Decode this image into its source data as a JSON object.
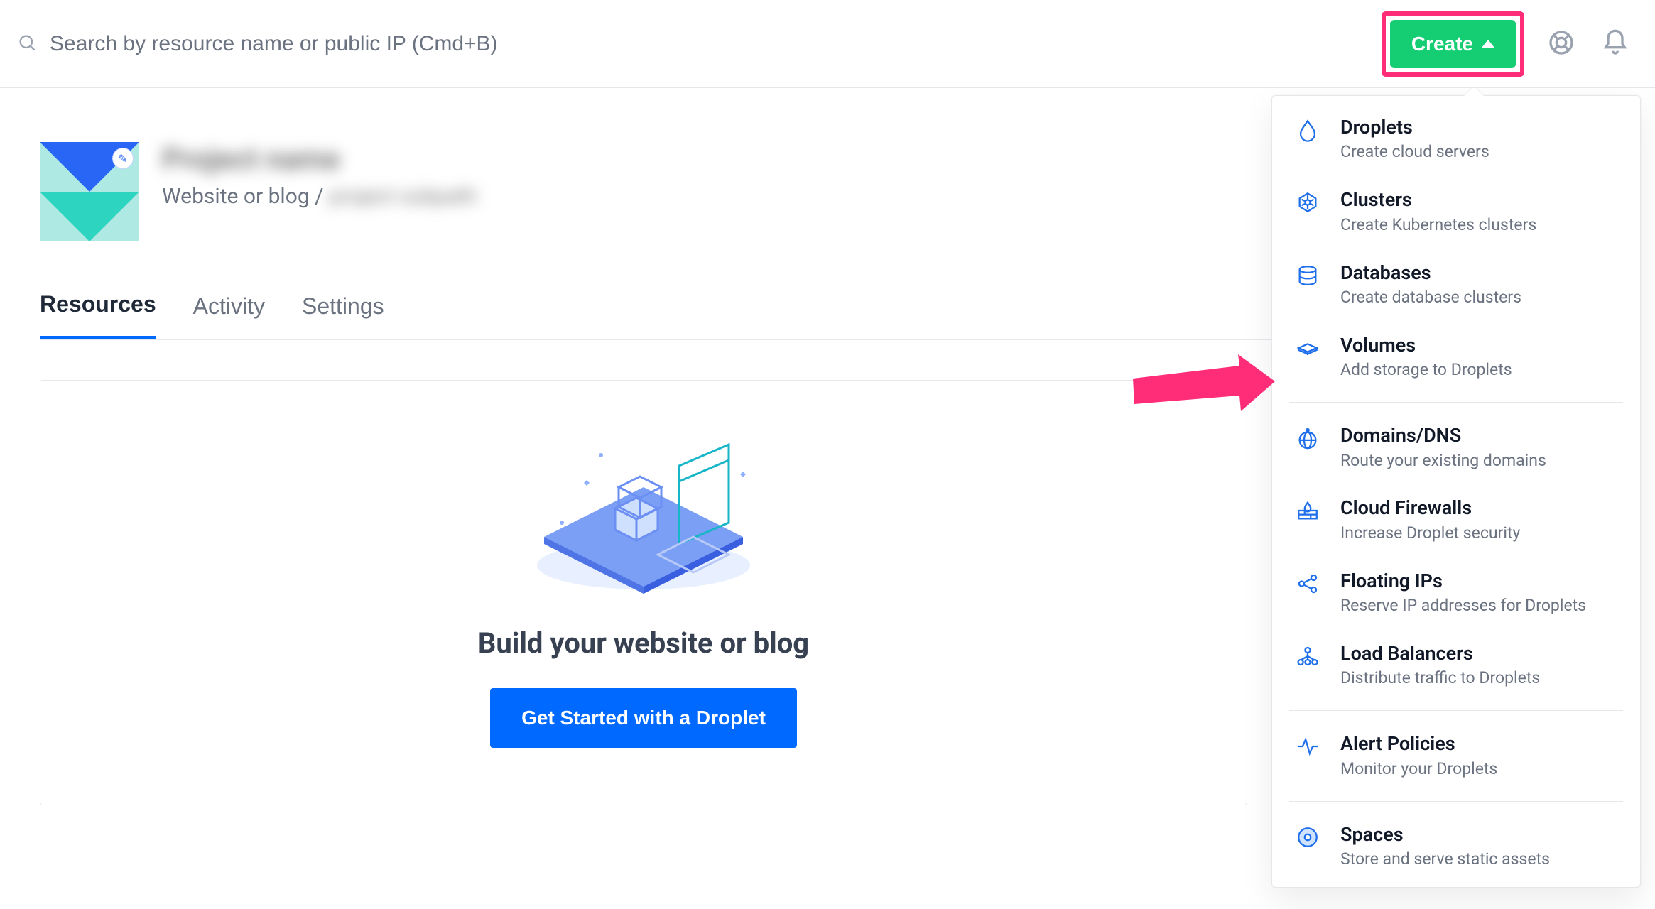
{
  "topbar": {
    "search_placeholder": "Search by resource name or public IP (Cmd+B)",
    "create_label": "Create"
  },
  "project": {
    "name_blurred": "Project name",
    "subtitle_prefix": "Website or blog /",
    "subtitle_blurred": "project subpath"
  },
  "tabs": [
    {
      "id": "resources",
      "label": "Resources",
      "active": true
    },
    {
      "id": "activity",
      "label": "Activity",
      "active": false
    },
    {
      "id": "settings",
      "label": "Settings",
      "active": false
    }
  ],
  "empty_state": {
    "heading": "Build your website or blog",
    "cta_label": "Get Started with a Droplet"
  },
  "create_menu": {
    "groups": [
      [
        {
          "id": "droplets",
          "title": "Droplets",
          "sub": "Create cloud servers",
          "icon": "droplet"
        },
        {
          "id": "clusters",
          "title": "Clusters",
          "sub": "Create Kubernetes clusters",
          "icon": "k8s"
        },
        {
          "id": "databases",
          "title": "Databases",
          "sub": "Create database clusters",
          "icon": "db"
        },
        {
          "id": "volumes",
          "title": "Volumes",
          "sub": "Add storage to Droplets",
          "icon": "volume"
        }
      ],
      [
        {
          "id": "domains",
          "title": "Domains/DNS",
          "sub": "Route your existing domains",
          "icon": "globe"
        },
        {
          "id": "firewalls",
          "title": "Cloud Firewalls",
          "sub": "Increase Droplet security",
          "icon": "wall"
        },
        {
          "id": "floating-ips",
          "title": "Floating IPs",
          "sub": "Reserve IP addresses for Droplets",
          "icon": "share"
        },
        {
          "id": "load-balancers",
          "title": "Load Balancers",
          "sub": "Distribute traffic to Droplets",
          "icon": "lb"
        }
      ],
      [
        {
          "id": "alert-policies",
          "title": "Alert Policies",
          "sub": "Monitor your Droplets",
          "icon": "pulse"
        }
      ],
      [
        {
          "id": "spaces",
          "title": "Spaces",
          "sub": "Store and serve static assets",
          "icon": "disc"
        }
      ]
    ]
  },
  "annotations": {
    "highlight_target": "create-button",
    "arrow_target": "create-menu-item-databases"
  }
}
